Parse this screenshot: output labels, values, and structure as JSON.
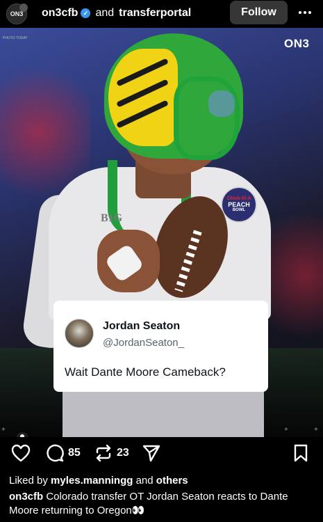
{
  "header": {
    "avatar_text": "ON3",
    "account_name": "on3cfb",
    "joiner": "and",
    "collaborator": "transferportal",
    "follow_label": "Follow"
  },
  "media": {
    "watermark": "ON3",
    "credit_text": "PHOTO TODAY",
    "jersey_patch": "B1G",
    "bowl_patch_top": "Chick-fil-A",
    "bowl_patch_main": "PEACH",
    "bowl_patch_bottom": "BOWL"
  },
  "tweet": {
    "name": "Jordan Seaton",
    "handle": "@JordanSeaton_",
    "text": "Wait Dante Moore Cameback?"
  },
  "actions": {
    "comment_count": "85",
    "repost_count": "23"
  },
  "caption": {
    "liked_prefix": "Liked by",
    "liked_user": "myles.manningg",
    "liked_and": "and",
    "liked_others": "others",
    "author": "on3cfb",
    "text": "Colorado transfer OT Jordan Seaton reacts to Dante Moore returning to Oregon👀"
  },
  "colors": {
    "background": "#000000",
    "follow_button": "#363636",
    "verified": "#3897f0",
    "helmet_green": "#2fa73a",
    "helmet_yellow": "#f1d316"
  }
}
